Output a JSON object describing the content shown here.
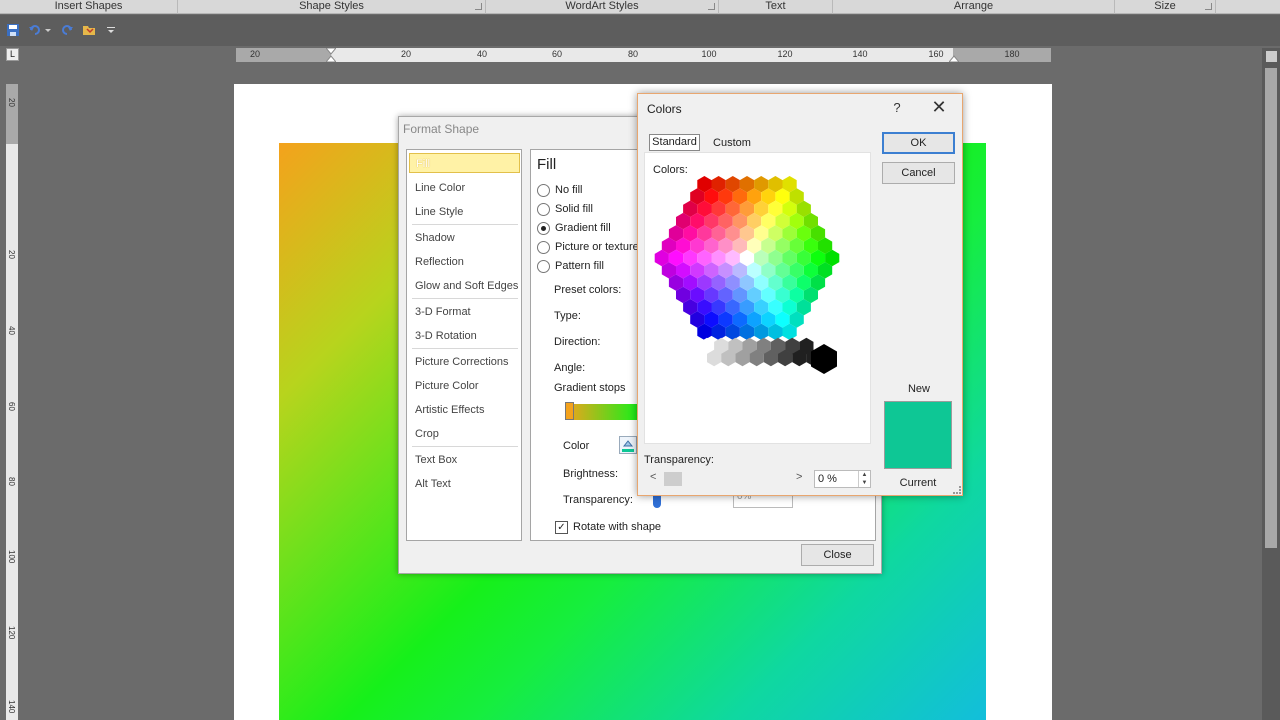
{
  "ribbon_groups": {
    "insert_shapes": "Insert Shapes",
    "shape_styles": "Shape Styles",
    "wordart_styles": "WordArt Styles",
    "text": "Text",
    "arrange": "Arrange",
    "size": "Size"
  },
  "ruler": {
    "h_numbers": [
      "20",
      "20",
      "40",
      "60",
      "80",
      "100",
      "120",
      "140",
      "160",
      "180"
    ],
    "v_numbers": [
      "20",
      "20",
      "40",
      "60",
      "80",
      "100",
      "120",
      "140"
    ]
  },
  "ruler_toggle": "L",
  "format_shape": {
    "title": "Format Shape",
    "nav": [
      "Fill",
      "Line Color",
      "Line Style",
      "Shadow",
      "Reflection",
      "Glow and Soft Edges",
      "3-D Format",
      "3-D Rotation",
      "Picture Corrections",
      "Picture Color",
      "Artistic Effects",
      "Crop",
      "Text Box",
      "Alt Text"
    ],
    "heading": "Fill",
    "options": {
      "no_fill": "No fill",
      "solid_fill": "Solid fill",
      "gradient_fill": "Gradient fill",
      "picture_fill": "Picture or texture fill",
      "pattern_fill": "Pattern fill"
    },
    "preset_colors": "Preset colors:",
    "type": "Type:",
    "direction": "Direction:",
    "angle": "Angle:",
    "gradient_stops": "Gradient stops",
    "color": "Color",
    "brightness": "Brightness:",
    "transparency": "Transparency:",
    "transparency_value": "0%",
    "rotate_with_shape": "Rotate with shape",
    "close": "Close"
  },
  "colors_dialog": {
    "title": "Colors",
    "help": "?",
    "close": "✕",
    "tab_standard": "Standard",
    "tab_custom": "Custom",
    "colors_label": "Colors:",
    "ok": "OK",
    "cancel": "Cancel",
    "new_label": "New",
    "current_label": "Current",
    "new_color": "#0ec795",
    "transparency_label": "Transparency:",
    "transparency_value": "0 %"
  },
  "colors": {
    "shape_gradient": [
      "#f4a21c",
      "#16f01a",
      "#12bedb"
    ],
    "ok_border": "#3c7fd1"
  }
}
